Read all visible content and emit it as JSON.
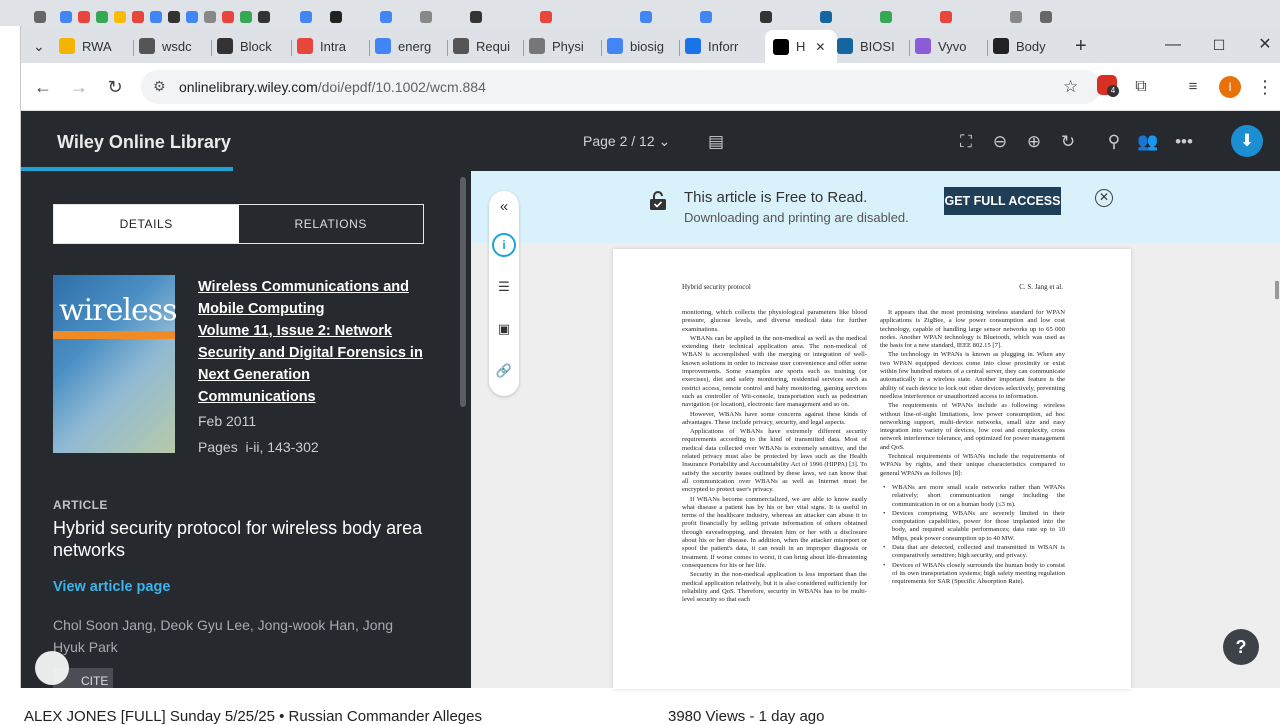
{
  "bg": {
    "bottom_left": "ALEX JONES [FULL] Sunday 5/25/25 • Russian Commander Alleges",
    "bottom_right": "3980 Views - 1 day ago"
  },
  "browser": {
    "tabs": [
      {
        "label": "RWA",
        "icon": "doc-icon",
        "color": "#f4b400"
      },
      {
        "label": "wsdc",
        "icon": "globe-icon",
        "color": "#555555"
      },
      {
        "label": "Block",
        "icon": "r-icon",
        "color": "#333333"
      },
      {
        "label": "Intra",
        "icon": "e-icon",
        "color": "#e8453c"
      },
      {
        "label": "energ",
        "icon": "google-icon",
        "color": "#4285f4"
      },
      {
        "label": "Requi",
        "icon": "lock-icon",
        "color": "#555555"
      },
      {
        "label": "Physi",
        "icon": "puzzle-icon",
        "color": "#777777"
      },
      {
        "label": "biosig",
        "icon": "google-icon",
        "color": "#4285f4"
      },
      {
        "label": "Inforr",
        "icon": "inform-icon",
        "color": "#1a73e8"
      },
      {
        "label": "H",
        "icon": "wiley-icon",
        "color": "#000000",
        "active": true
      },
      {
        "label": "BIOSI",
        "icon": "biosi-icon",
        "color": "#1565a0"
      },
      {
        "label": "Vyvo",
        "icon": "heart-icon",
        "color": "#8a5cd6"
      },
      {
        "label": "Body",
        "icon": "wikipedia-icon",
        "color": "#222222"
      }
    ],
    "new_tab": "+",
    "url_host": "onlinelibrary.wiley.com",
    "url_path": "/doi/epdf/10.1002/wcm.884",
    "badge_count": "4",
    "profile_initial": "I"
  },
  "wiley": {
    "brand": "Wiley Online Library",
    "page_indicator": "Page 2 / 12",
    "tabs": {
      "details": "DETAILS",
      "relations": "RELATIONS"
    },
    "cover_word": "wireless",
    "journal_lines": [
      "Wireless Communications and",
      "Mobile Computing",
      "Volume 11, Issue 2: Network",
      "Security and Digital Forensics in",
      "Next Generation",
      "Communications"
    ],
    "date": "Feb 2011",
    "pages_label": "Pages",
    "pages_value": "i-ii, 143-302",
    "article_label": "ARTICLE",
    "article_title": "Hybrid security protocol for wireless body area networks",
    "view_article": "View article page",
    "authors": "Chol Soon Jang, Deok Gyu Lee, Jong-wook Han, Jong Hyuk Park",
    "cite": "CITE",
    "banner_line1": "This article is Free to Read.",
    "banner_line2": "Downloading and printing are disabled.",
    "get_access": "GET FULL ACCESS"
  },
  "pdf": {
    "header_left": "Hybrid security protocol",
    "header_right": "C. S. Jang et al.",
    "col1": [
      "monitoring, which collects the physiological parameters like blood pressure, glucose levels, and diverse medical data for further examinations.",
      "WBANs can be applied in the non-medical as well as the medical extending their technical application area. The non-medical of WBAN is accomplished with the merging or integration of well-known solutions in order to increase user convenience and offer some improvements. Some examples are sports such as training (or exercises), diet and safety monitoring, residential services such as restrict access, remote control and baby monitoring, gaming services such as controller of Wii-console, transportation such as pedestrian navigation (or location), electronic fare management and so on.",
      "However, WBANs have some concerns against these kinds of advantages. These include privacy, security, and legal aspects.",
      "Applications of WBANs have extremely different security requirements according to the kind of transmitted data. Most of medical data collected over WBANs is extremely sensitive, and the related privacy must also be protected by laws such as the Health Insurance Portability and Accountability Act of 1996 (HIPPA) [3]. To satisfy the security issues outlined by these laws, we can know that all communication over WBANs as well as Internet must be encrypted to protect user's privacy.",
      "If WBANs become commercialized, we are able to know easily what disease a patient has by his or her vital signs. It is useful in terms of the healthcare industry, whereas an attacker can abuse it to profit financially by selling private information of others obtained through eavesdropping, and threaten him or her with a disclosure about his or her disease. In addition, when the attacker misreport or spoof the patient's data, it can result in an improper diagnosis or treatment. If worse comes to worst, it can bring about life-threatening consequences for his or her life.",
      "Security in the non-medical application is less important than the medical application relatively, but it is also considered sufficiently for reliability and QoS. Therefore, security in WBANs has to be multi-level security so that each"
    ],
    "col2": [
      "It appears that the most promising wireless standard for WPAN applications is ZigBee, a low power consumption and low cost technology, capable of handling large sensor networks up to 65 000 nodes. Another WPAN technology is Bluetooth, which was used as the basis for a new standard, IEEE 802.15 [7].",
      "The technology in WPANs is known as plugging in. When any two WPAN equipped devices come into close proximity or exist within few hundred meters of a central server, they can communicate automatically in a wireless state. Another important feature is the ability of each device to lock out other devices selectively, preventing needless interference or unauthorized access to information.",
      "The requirements of WPANs include as following: wireless without line-of-sight limitations, low power consumption, ad hoc networking support, multi-device networks, small size and easy integration into variety of devices, low cost and complexity, cross network interference tolerance, and optimized for power management and QoS.",
      "Technical requirements of WBANs include the requirements of WPANs by rights, and their unique characteristics compared to general WPANs as follows [8]:"
    ],
    "col2_bullets": [
      "WBANs are more small scale networks rather than WPANs relatively; short communication range including the communication in or on a human body (≤3 m).",
      "Devices comprising WBANs are severely limited in their computation capabilities, power for those implanted into the body, and required scalable performances; data rate up to 10 Mbps, peak power consumption up to 40 MW.",
      "Data that are detected, collected and transmitted in WBAN is comparatively sensitive; high security, and privacy.",
      "Devices of WBANs closely surrounds the human body to consist of its own transportation systems; high safety meeting regulation requirements for SAR (Specific Absorption Rate)."
    ]
  }
}
